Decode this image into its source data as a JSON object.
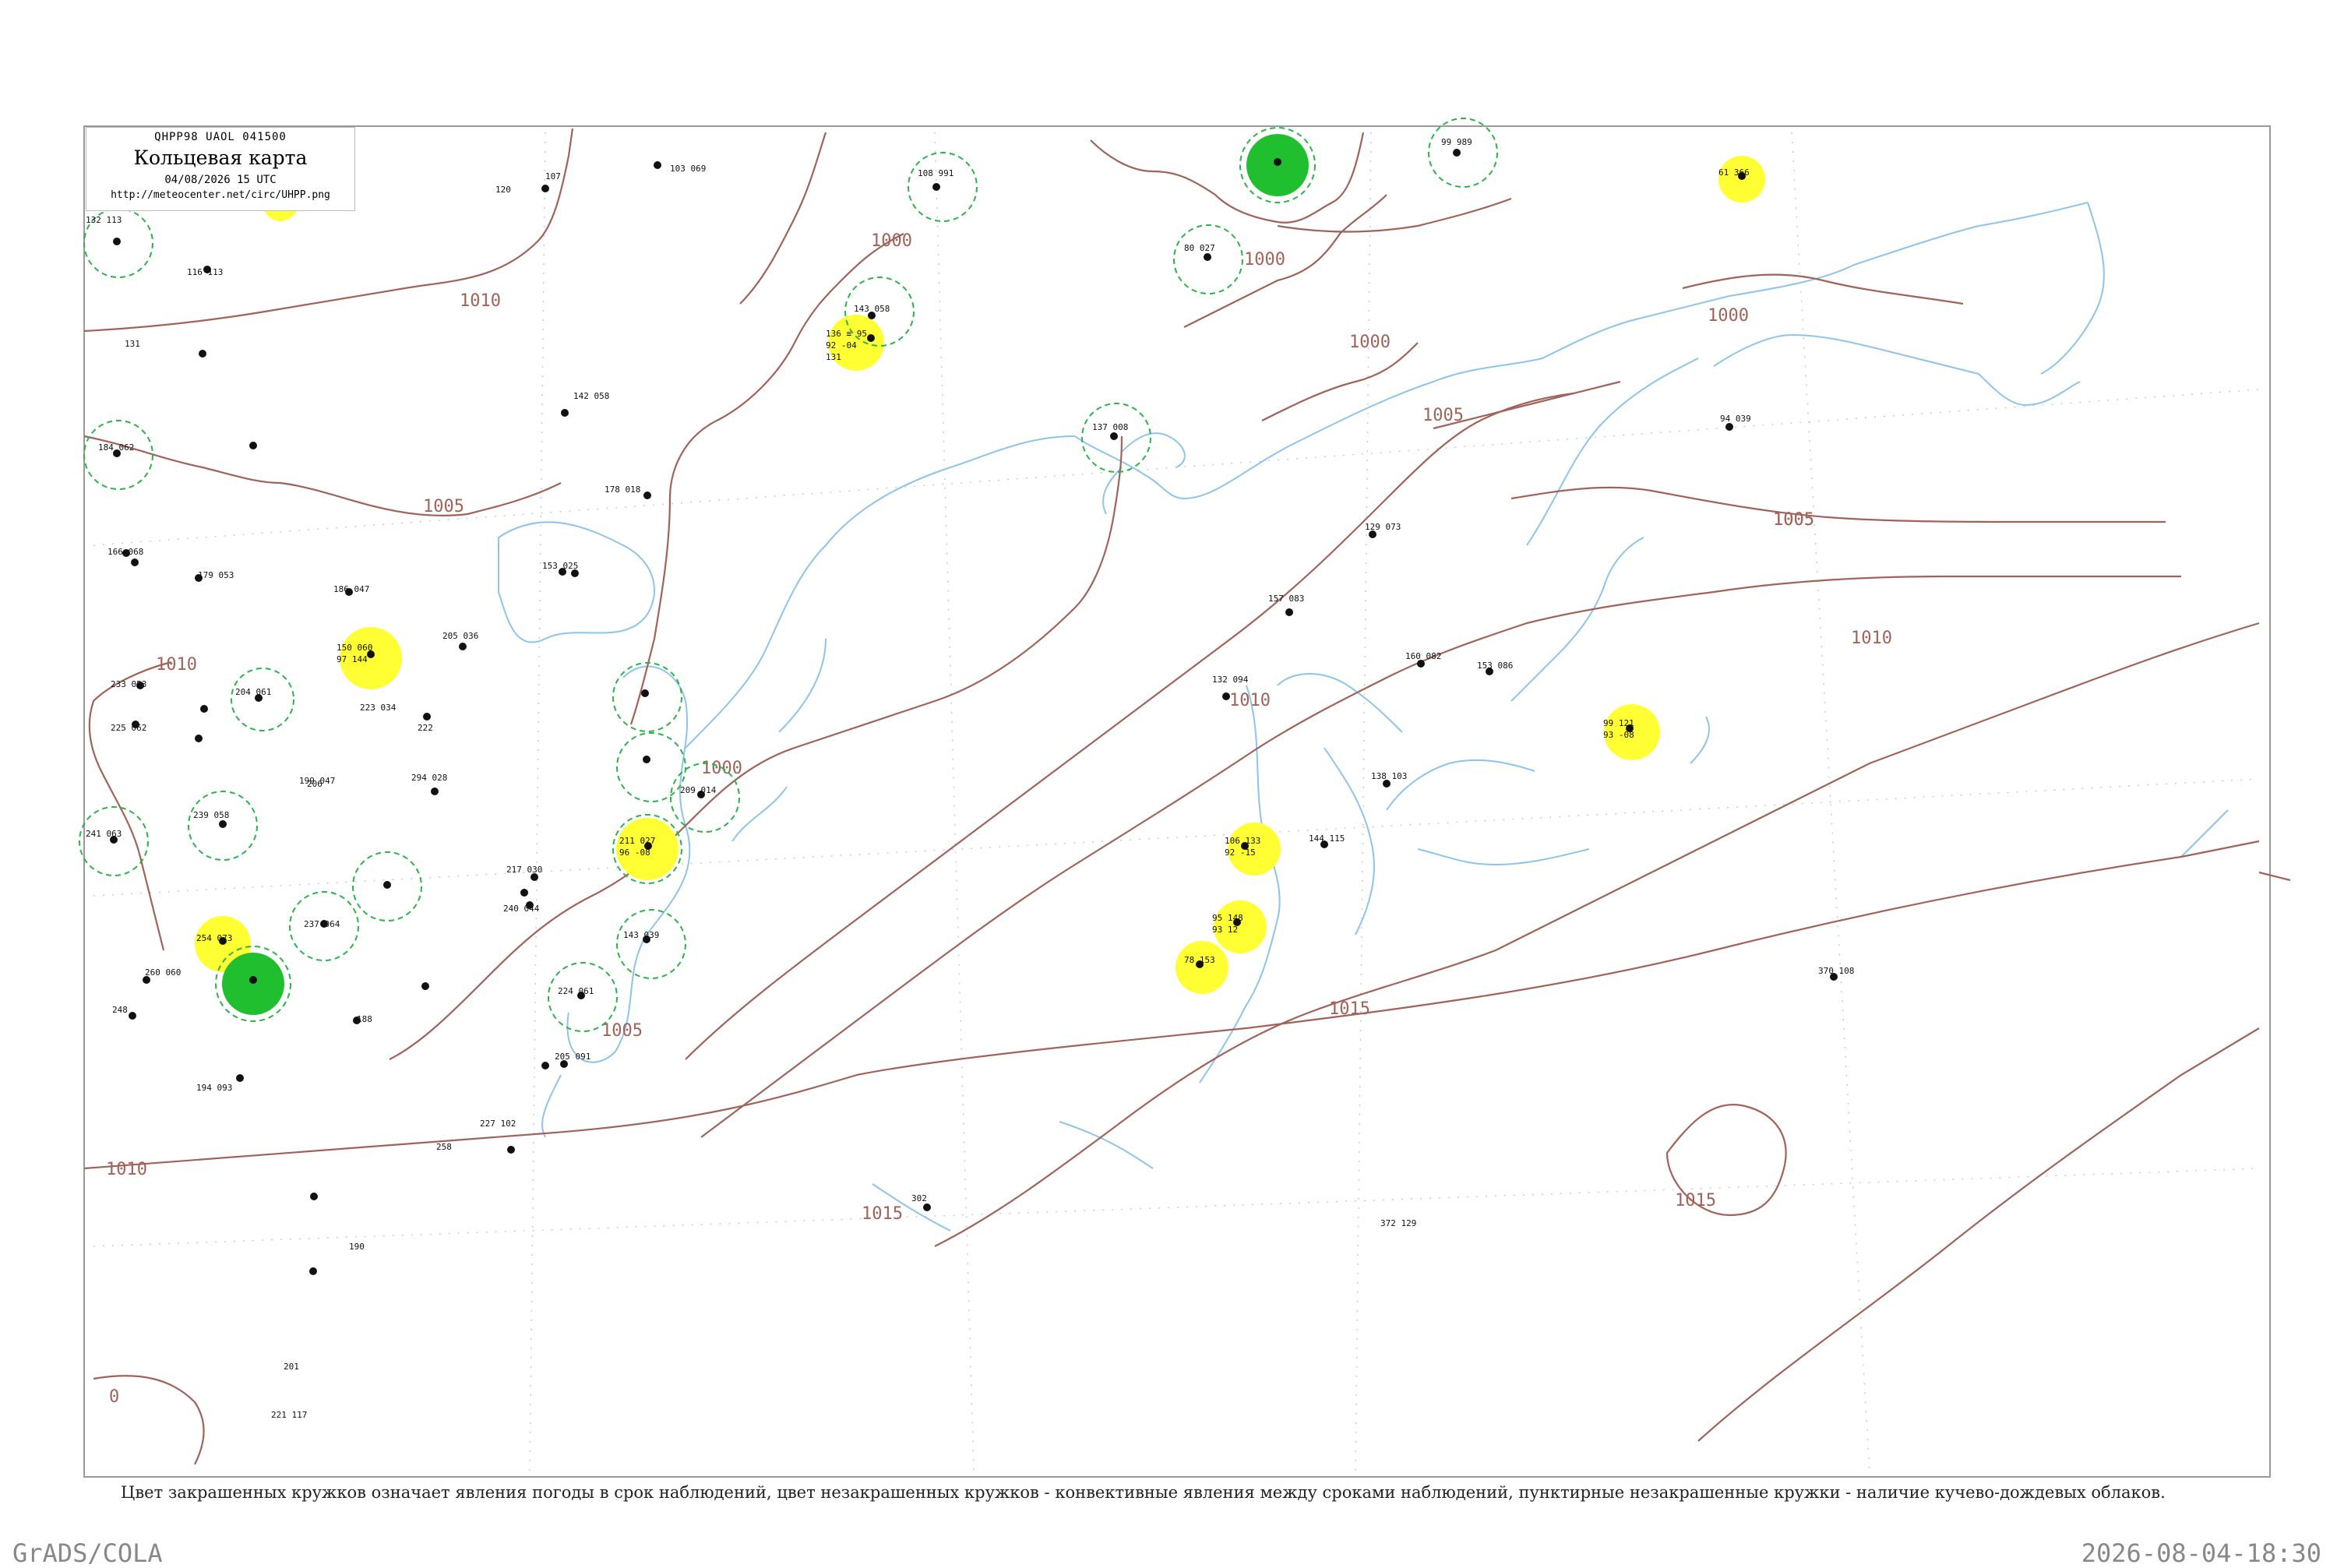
{
  "header": {
    "code": "QHPP98  UAOL  041500",
    "title": "Кольцевая карта",
    "datetime": "04/08/2026 15 UTC",
    "url": "http://meteocenter.net/circ/UHPP.png"
  },
  "caption": "Цвет закрашенных кружков означает явления погоды в срок наблюдений, цвет незакрашенных кружков - конвективные явления между сроками наблюдений, пунктирные незакрашенные кружки - наличие кучево-дождевых облаков.",
  "footer": {
    "software": "GrADS/COLA",
    "timestamp": "2026-08-04-18:30"
  },
  "colors": {
    "isobar": "#a0635a",
    "coast": "#8fc4ea",
    "frame": "#999999",
    "yellow_fill": "#ffff33",
    "green_fill": "#1fbf2f",
    "dashed_ring": "#2db34a"
  },
  "isobar_labels": [
    {
      "text": "1010"
    },
    {
      "text": "1005"
    },
    {
      "text": "1005"
    },
    {
      "text": "1010"
    },
    {
      "text": "1005"
    },
    {
      "text": "1000"
    },
    {
      "text": "1000"
    },
    {
      "text": "1000"
    },
    {
      "text": "1000"
    },
    {
      "text": "1005"
    },
    {
      "text": "1005"
    },
    {
      "text": "1010"
    },
    {
      "text": "1010"
    },
    {
      "text": "1015"
    },
    {
      "text": "1015"
    },
    {
      "text": "1015"
    },
    {
      "text": "1000"
    },
    {
      "text": "1010"
    },
    {
      "text": "0"
    }
  ],
  "station_values": [
    {
      "text": "136 ≡ 95"
    },
    {
      "text": "92 -04"
    },
    {
      "text": "131"
    },
    {
      "text": "143 058"
    },
    {
      "text": "106 133"
    },
    {
      "text": "92 -15"
    },
    {
      "text": "95 148"
    },
    {
      "text": "93 12"
    },
    {
      "text": "78 153"
    },
    {
      "text": "99 121"
    },
    {
      "text": "93 -08"
    },
    {
      "text": "61 366"
    },
    {
      "text": "150 060"
    },
    {
      "text": "97 144"
    },
    {
      "text": "254 073"
    },
    {
      "text": "211 027"
    },
    {
      "text": "96 -08"
    },
    {
      "text": "209 014"
    },
    {
      "text": "237 064"
    },
    {
      "text": "239 058"
    },
    {
      "text": "241 063"
    },
    {
      "text": "184 062"
    },
    {
      "text": "233 053"
    },
    {
      "text": "225 062"
    },
    {
      "text": "204 061"
    },
    {
      "text": "186 047"
    },
    {
      "text": "205 036"
    },
    {
      "text": "153 025"
    },
    {
      "text": "178 018"
    },
    {
      "text": "103 069"
    },
    {
      "text": "107"
    },
    {
      "text": "120"
    },
    {
      "text": "132 113"
    },
    {
      "text": "116 113"
    },
    {
      "text": "131"
    },
    {
      "text": "142 058"
    },
    {
      "text": "137 008"
    },
    {
      "text": "129 073"
    },
    {
      "text": "157 083"
    },
    {
      "text": "160 082"
    },
    {
      "text": "153 086"
    },
    {
      "text": "132 094"
    },
    {
      "text": "138 103"
    },
    {
      "text": "144 115"
    },
    {
      "text": "94 039"
    },
    {
      "text": "370 108"
    },
    {
      "text": "372 129"
    },
    {
      "text": "302"
    },
    {
      "text": "258"
    },
    {
      "text": "227 102"
    },
    {
      "text": "224 061"
    },
    {
      "text": "205 091"
    },
    {
      "text": "190"
    },
    {
      "text": "201"
    },
    {
      "text": "221 117"
    },
    {
      "text": "260 060"
    },
    {
      "text": "248"
    },
    {
      "text": "194 093"
    },
    {
      "text": "188"
    },
    {
      "text": "217 030"
    },
    {
      "text": "240 044"
    },
    {
      "text": "143 039"
    },
    {
      "text": "222"
    },
    {
      "text": "294 028"
    },
    {
      "text": "223 034"
    },
    {
      "text": "166 068"
    },
    {
      "text": "179 053"
    },
    {
      "text": "206"
    },
    {
      "text": "199 047"
    },
    {
      "text": "80 027"
    },
    {
      "text": "108 991"
    },
    {
      "text": "99 989"
    }
  ]
}
